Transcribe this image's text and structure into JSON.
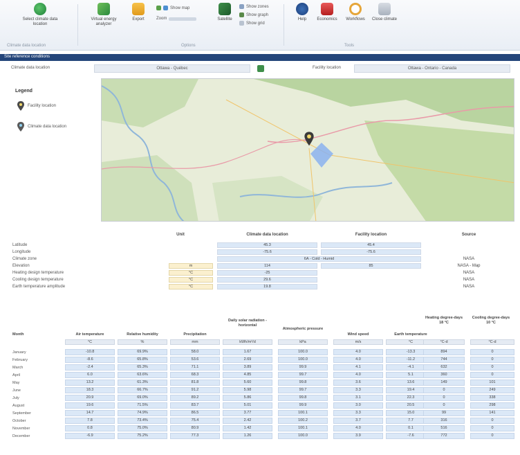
{
  "ribbon": {
    "select_location_label": "Select climate data location",
    "group_climate_label": "Climate data location",
    "facility_label": "Virtual energy analyzer",
    "export_label": "Export",
    "show_map_label": "Show map",
    "zoom_label": "Zoom",
    "satellite_label": "Satellite",
    "show_zones_label": "Show zones",
    "show_graph_label": "Show graph",
    "show_grid_label": "Show grid",
    "group_options_label": "Options",
    "help_label": "Help",
    "economics_label": "Economics",
    "workflows_label": "Workflows",
    "close_label": "Close climate",
    "group_tools_label": "Tools"
  },
  "section_title": "Site reference conditions",
  "location": {
    "climate_label": "Climate data location",
    "climate_value": "Ottawa - Québec",
    "facility_label": "Facility location",
    "facility_value": "Ottawa - Ontario - Canada"
  },
  "legend": {
    "title": "Legend",
    "items": [
      {
        "label": "Facility location",
        "icon": "map-pin-icon"
      },
      {
        "label": "Climate data location",
        "icon": "climate-pin-icon"
      }
    ]
  },
  "properties": {
    "headers": {
      "unit": "Unit",
      "climate": "Climate data location",
      "facility": "Facility location",
      "source": "Source"
    },
    "rows": [
      {
        "label": "Latitude",
        "unit": "",
        "climate": "45.3",
        "facility": "45.4",
        "source": ""
      },
      {
        "label": "Longitude",
        "unit": "",
        "climate": "-75.6",
        "facility": "-75.6",
        "source": ""
      },
      {
        "label": "Climate zone",
        "unit": "",
        "climate": "6A - Cold - Humid",
        "facility": "",
        "source": "NASA"
      },
      {
        "label": "Elevation",
        "unit": "m",
        "climate": "114",
        "facility": "85",
        "source": "NASA - Map"
      },
      {
        "label": "Heating design temperature",
        "unit": "°C",
        "climate": "-25",
        "facility": "",
        "source": "NASA"
      },
      {
        "label": "Cooling design temperature",
        "unit": "°C",
        "climate": "29.6",
        "facility": "",
        "source": "NASA"
      },
      {
        "label": "Earth temperature amplitude",
        "unit": "°C",
        "climate": "19.8",
        "facility": "",
        "source": "NASA"
      }
    ]
  },
  "monthly": {
    "headers": [
      "Month",
      "Air temperature",
      "Relative humidity",
      "Precipitation",
      "Daily solar radiation - horizontal",
      "Atmospheric pressure",
      "Wind speed",
      "Earth temperature",
      "Heating degree-days 18 °C",
      "Cooling degree-days 10 °C"
    ],
    "units": [
      "°C",
      "%",
      "mm",
      "kWh/m²/d",
      "kPa",
      "m/s",
      "°C",
      "°C-d",
      "°C-d"
    ],
    "rows": [
      {
        "month": "January",
        "values": [
          "-10.8",
          "69.9%",
          "58.0",
          "1.67",
          "100.0",
          "4.0",
          "-13.3",
          "894",
          "0"
        ]
      },
      {
        "month": "February",
        "values": [
          "-8.6",
          "65.8%",
          "53.6",
          "2.69",
          "100.0",
          "4.0",
          "-11.2",
          "744",
          "0"
        ]
      },
      {
        "month": "March",
        "values": [
          "-2.4",
          "65.3%",
          "71.1",
          "3.89",
          "99.9",
          "4.1",
          "-4.1",
          "632",
          "0"
        ]
      },
      {
        "month": "April",
        "values": [
          "6.0",
          "63.6%",
          "68.3",
          "4.85",
          "99.7",
          "4.0",
          "5.1",
          "360",
          "0"
        ]
      },
      {
        "month": "May",
        "values": [
          "13.2",
          "61.3%",
          "81.8",
          "5.60",
          "99.8",
          "3.6",
          "13.6",
          "149",
          "101"
        ]
      },
      {
        "month": "June",
        "values": [
          "18.3",
          "66.7%",
          "91.2",
          "5.98",
          "99.7",
          "3.3",
          "19.4",
          "0",
          "249"
        ]
      },
      {
        "month": "July",
        "values": [
          "20.9",
          "69.0%",
          "89.2",
          "5.86",
          "99.8",
          "3.1",
          "22.3",
          "0",
          "338"
        ]
      },
      {
        "month": "August",
        "values": [
          "19.6",
          "71.5%",
          "83.7",
          "5.01",
          "99.9",
          "3.0",
          "20.5",
          "0",
          "298"
        ]
      },
      {
        "month": "September",
        "values": [
          "14.7",
          "74.9%",
          "86.5",
          "3.77",
          "100.1",
          "3.3",
          "15.0",
          "99",
          "141"
        ]
      },
      {
        "month": "October",
        "values": [
          "7.8",
          "73.4%",
          "75.4",
          "2.42",
          "100.2",
          "3.7",
          "7.7",
          "316",
          "0"
        ]
      },
      {
        "month": "November",
        "values": [
          "0.8",
          "75.0%",
          "80.9",
          "1.42",
          "100.1",
          "4.0",
          "0.1",
          "516",
          "0"
        ]
      },
      {
        "month": "December",
        "values": [
          "-6.9",
          "75.2%",
          "77.3",
          "1.26",
          "100.0",
          "3.9",
          "-7.6",
          "772",
          "0"
        ]
      }
    ]
  },
  "colors": {
    "accent": "#24457a",
    "cell_blue": "#dbe8f7",
    "unit_yellow": "#fbf0cf"
  }
}
